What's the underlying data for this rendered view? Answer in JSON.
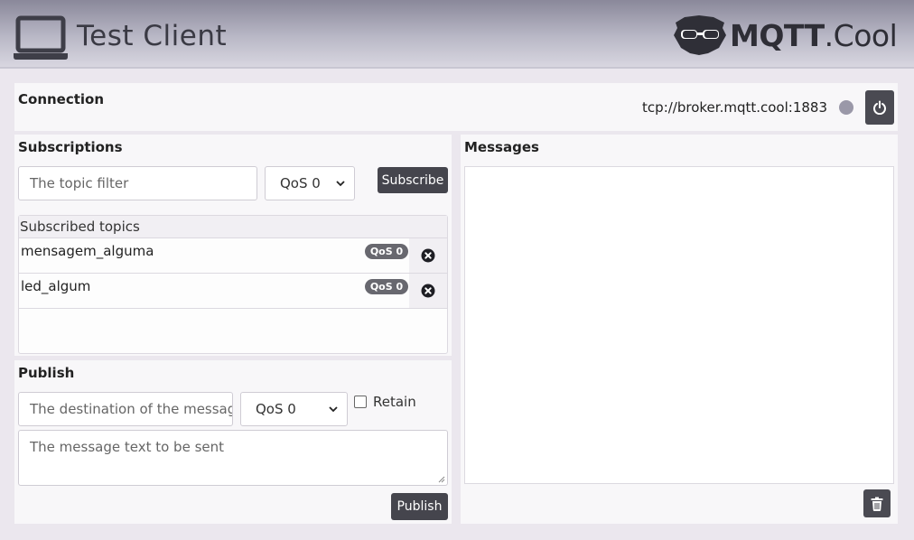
{
  "header": {
    "title": "Test Client",
    "brand_prefix": "MQTT",
    "brand_suffix": ".Cool",
    "icon": "laptop-icon",
    "brand_icon": "mqtt-cool-logo"
  },
  "connection": {
    "title": "Connection",
    "broker_url": "tcp://broker.mqtt.cool:1883",
    "status_color": "#9a98a8",
    "connect_icon": "power-icon"
  },
  "subscriptions": {
    "title": "Subscriptions",
    "topic_placeholder": "The topic filter",
    "qos_selected": "QoS 0",
    "subscribe_label": "Subscribe",
    "list_header": "Subscribed topics",
    "topics": [
      {
        "name": "mensagem_alguma",
        "qos": "QoS 0"
      },
      {
        "name": "led_algum",
        "qos": "QoS 0"
      }
    ]
  },
  "publish": {
    "title": "Publish",
    "destination_placeholder": "The destination of the messag",
    "qos_selected": "QoS 0",
    "retain_label": "Retain",
    "message_placeholder": "The message text to be sent",
    "publish_label": "Publish"
  },
  "messages": {
    "title": "Messages",
    "clear_icon": "trash-icon"
  },
  "colors": {
    "dark_button": "#45454d",
    "badge": "#68686f",
    "background": "#ebe7ee"
  }
}
